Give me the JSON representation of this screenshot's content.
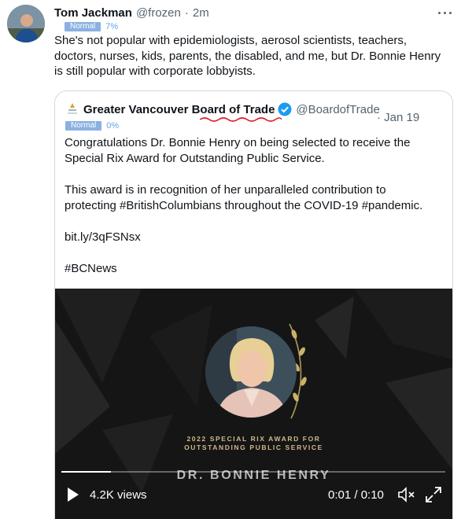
{
  "tweet": {
    "author_name": "Tom Jackman",
    "handle": "@frozen",
    "separator": "·",
    "time": "2m",
    "label_badge": "Normal",
    "label_percent": "7%",
    "text": "She's not popular with epidemiologists, aerosol scientists, teachers,\ndoctors, nurses, kids, parents, the disabled, and me, but Dr. Bonnie Henry\nis still popular with corporate lobbyists."
  },
  "quote": {
    "author_name": "Greater Vancouver Board of Trade",
    "handle": "@BoardofTrade",
    "time": "· Jan 19",
    "label_badge": "Normal",
    "label_percent": "0%",
    "text": "Congratulations Dr. Bonnie Henry on being selected to receive the\nSpecial Rix Award for Outstanding Public Service.\n\nThis award is in recognition of her unparalleled contribution to\nprotecting #BritishColumbians throughout the COVID-19 #pandemic.\n\nbit.ly/3qFSNsx\n\n#BCNews"
  },
  "media": {
    "award_line1": "2022 SPECIAL RIX AWARD FOR",
    "award_line2": "OUTSTANDING PUBLIC SERVICE",
    "honoree": "DR. BONNIE HENRY",
    "views": "4.2K views",
    "timecode": "0:01 / 0:10",
    "progress_fraction": 0.13
  },
  "icons": {
    "more": "more-icon",
    "verified": "verified-badge-icon",
    "play": "play-icon",
    "mute": "mute-icon",
    "fullscreen": "fullscreen-icon"
  },
  "colors": {
    "text_primary": "#0f1419",
    "text_secondary": "#536471",
    "verified_blue": "#1d9bf0",
    "label_badge_bg": "#8bb1e2",
    "label_percent": "#66a3e8",
    "annotation_red": "#e0202b",
    "award_gold": "#cfb98c"
  }
}
